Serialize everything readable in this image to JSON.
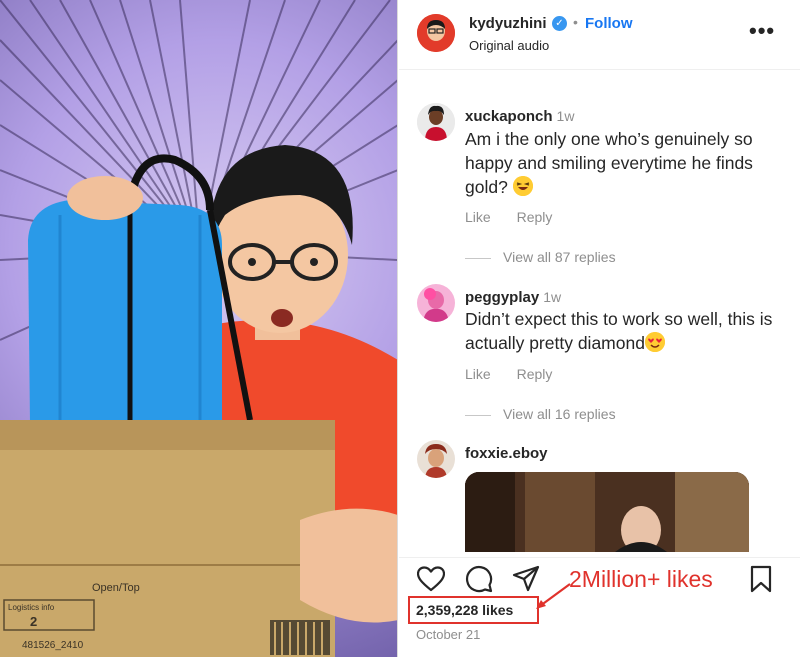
{
  "post": {
    "username": "kydyuzhini",
    "verified_mark": "✓",
    "separator": "•",
    "follow_label": "Follow",
    "audio_label": "Original audio",
    "more_label": "•••"
  },
  "comments": [
    {
      "username": "xuckaponch",
      "time": "1w",
      "text": "Am i the only one who’s genuinely so happy and smiling everytime he finds gold?",
      "like_label": "Like",
      "reply_label": "Reply",
      "view_replies": "View all 87 replies"
    },
    {
      "username": "peggyplay",
      "time": "1w",
      "text": "Didn’t expect this to work so well, this is actually pretty diamond",
      "like_label": "Like",
      "reply_label": "Reply",
      "view_replies": "View all 16 replies"
    },
    {
      "username": "foxxie.eboy"
    }
  ],
  "footer": {
    "likes": "2,359,228 likes",
    "date": "October 21",
    "annotation": "2Million+ likes"
  },
  "media": {
    "box_label_open": "Open/Top",
    "box_label_info": "Logistics info",
    "box_number": "2",
    "box_code": "481526_2410"
  },
  "icons": [
    "heart-icon",
    "comment-icon",
    "share-icon",
    "bookmark-icon",
    "more-icon",
    "verified-badge-icon"
  ],
  "colors": {
    "follow": "#1877f2",
    "annotation": "#e0322c",
    "verified": "#3897f0"
  }
}
